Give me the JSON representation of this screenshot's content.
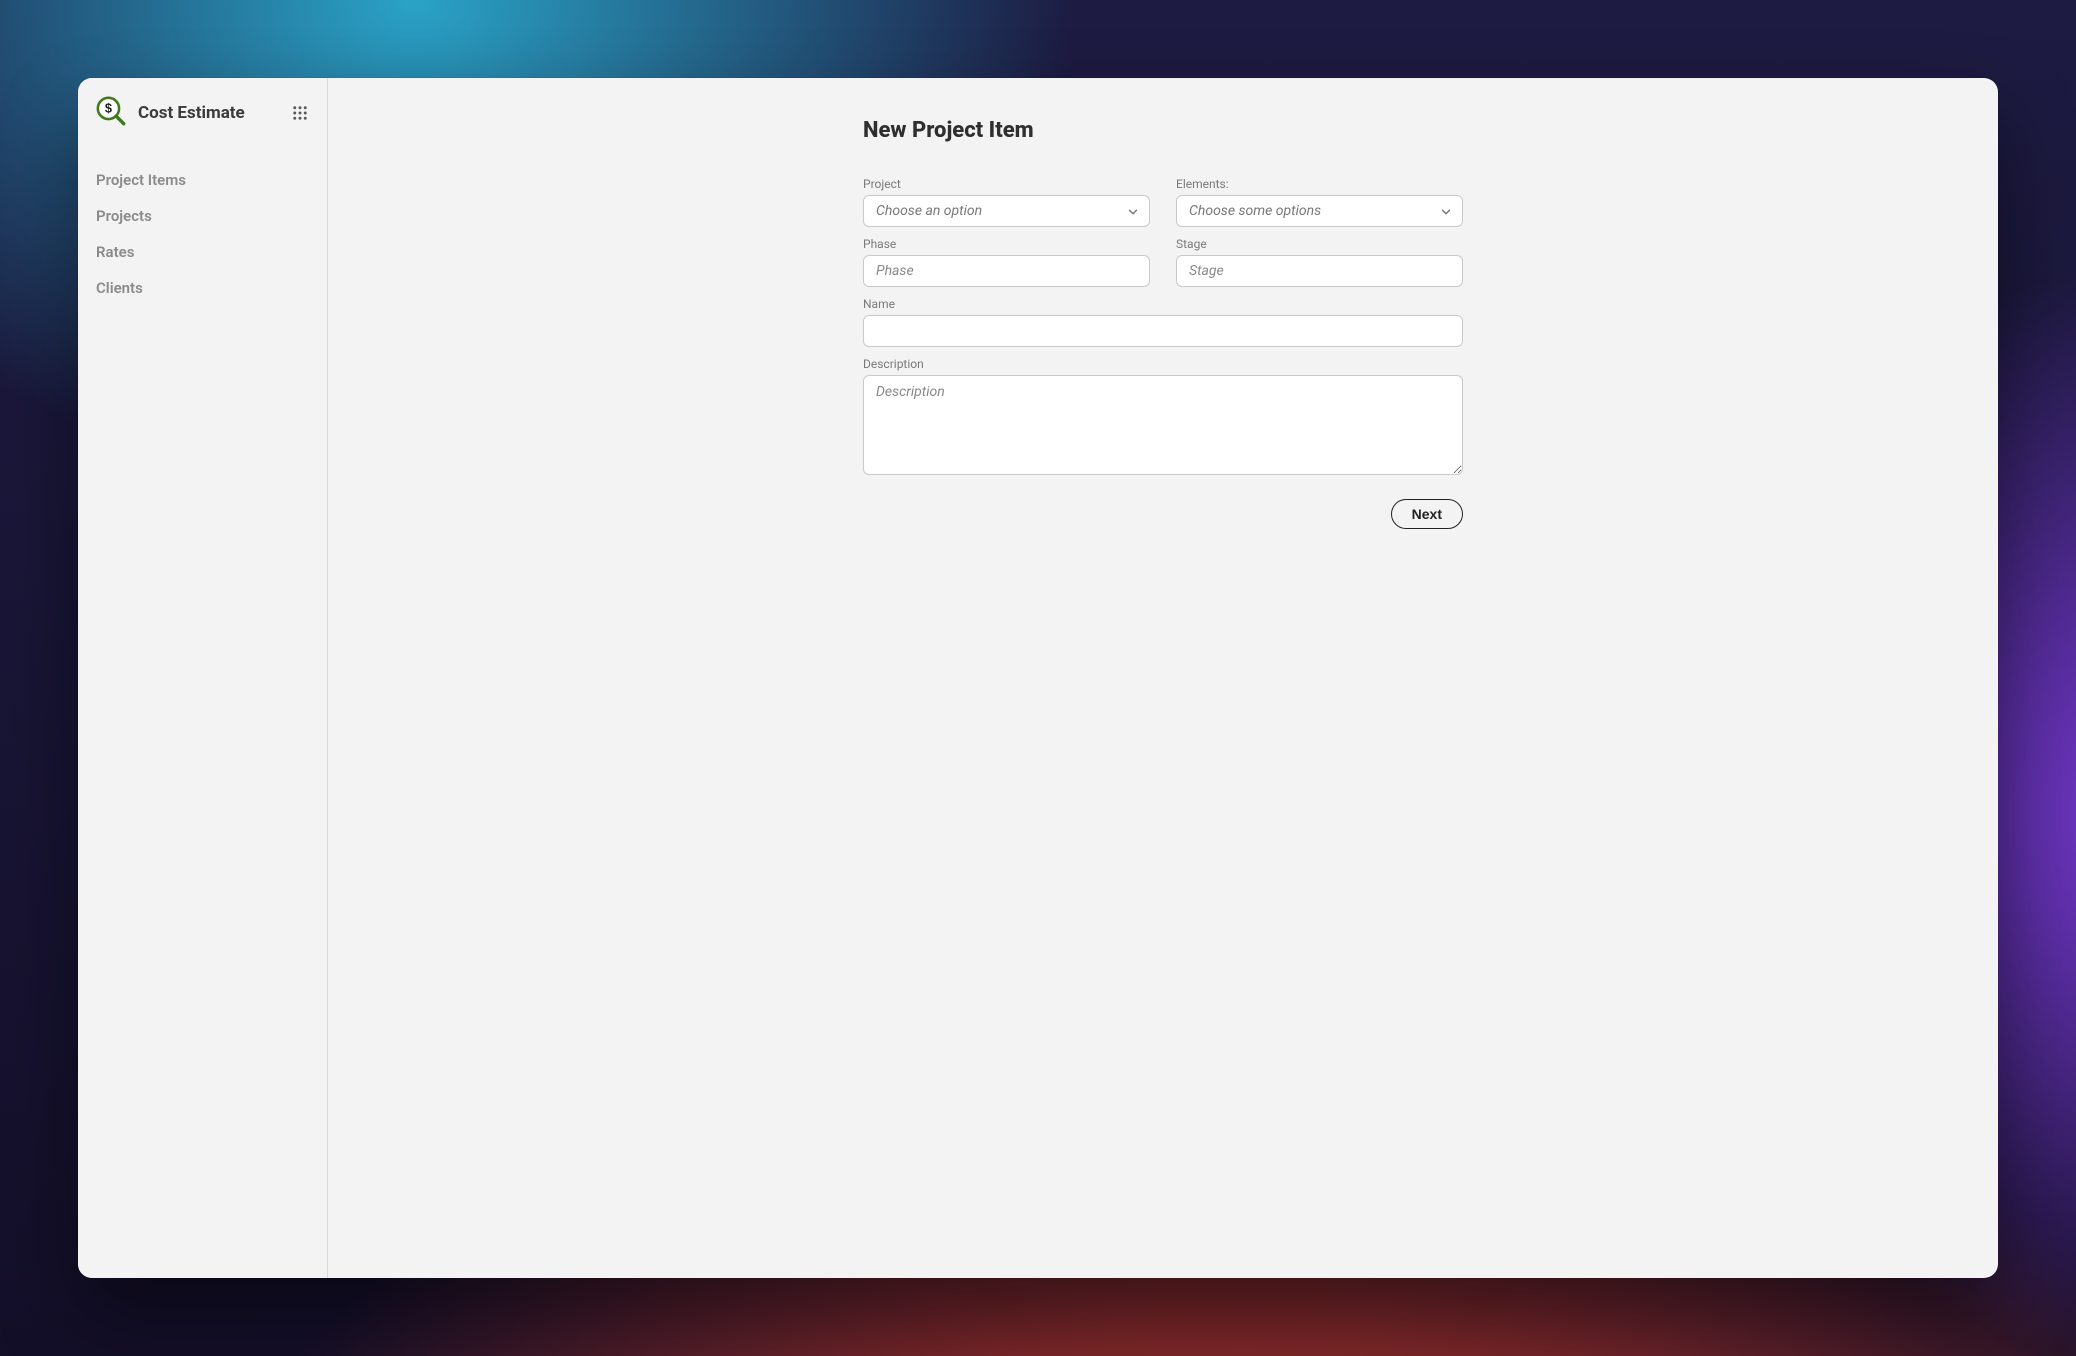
{
  "sidebar": {
    "appTitle": "Cost Estimate",
    "items": [
      {
        "label": "Project Items"
      },
      {
        "label": "Projects"
      },
      {
        "label": "Rates"
      },
      {
        "label": "Clients"
      }
    ]
  },
  "main": {
    "title": "New Project Item",
    "fields": {
      "project": {
        "label": "Project",
        "placeholder": "Choose an option"
      },
      "elements": {
        "label": "Elements:",
        "placeholder": "Choose some options"
      },
      "phase": {
        "label": "Phase",
        "placeholder": "Phase"
      },
      "stage": {
        "label": "Stage",
        "placeholder": "Stage"
      },
      "name": {
        "label": "Name",
        "placeholder": ""
      },
      "description": {
        "label": "Description",
        "placeholder": "Description"
      }
    },
    "nextLabel": "Next"
  }
}
